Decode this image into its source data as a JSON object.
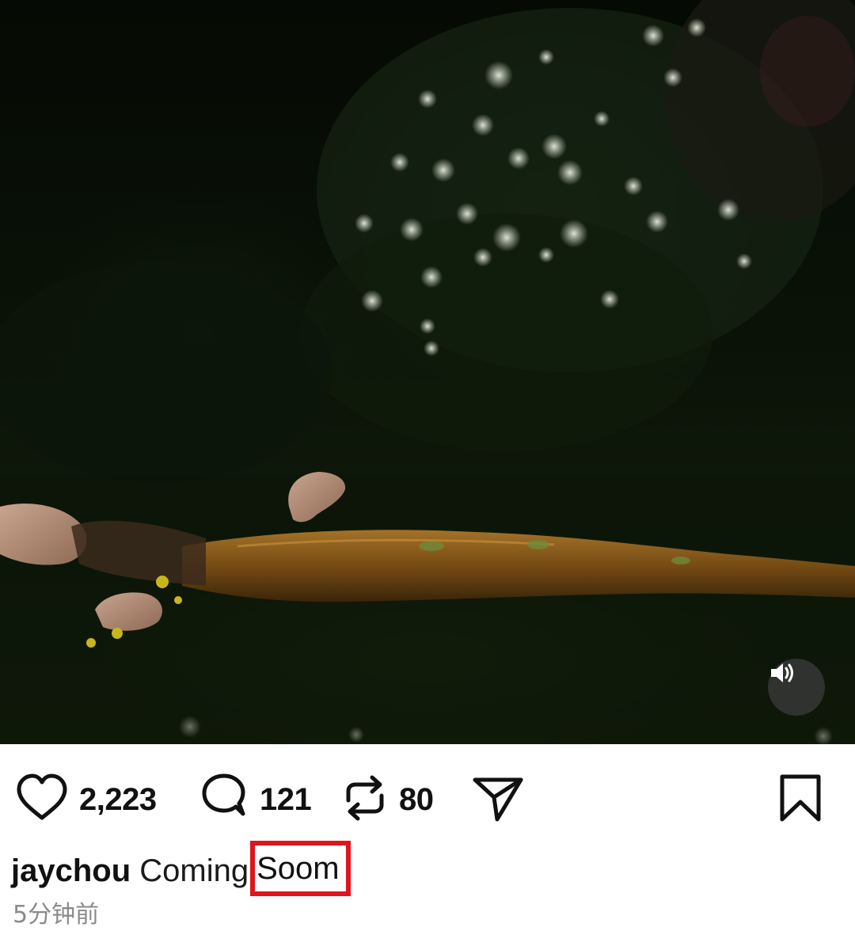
{
  "post": {
    "username": "jaychou",
    "caption_text": "Coming",
    "caption_highlight": "Soom",
    "timestamp": "5分钟前"
  },
  "actions": {
    "likes": "2,223",
    "comments": "121",
    "reposts": "80"
  },
  "icons": {
    "like": "heart-icon",
    "comment": "comment-bubble-icon",
    "repost": "repost-icon",
    "share": "send-icon",
    "save": "bookmark-icon",
    "sound": "speaker-icon"
  },
  "colors": {
    "highlight_box": "#e0141e",
    "text": "#111111",
    "muted": "#8a8a8a"
  }
}
